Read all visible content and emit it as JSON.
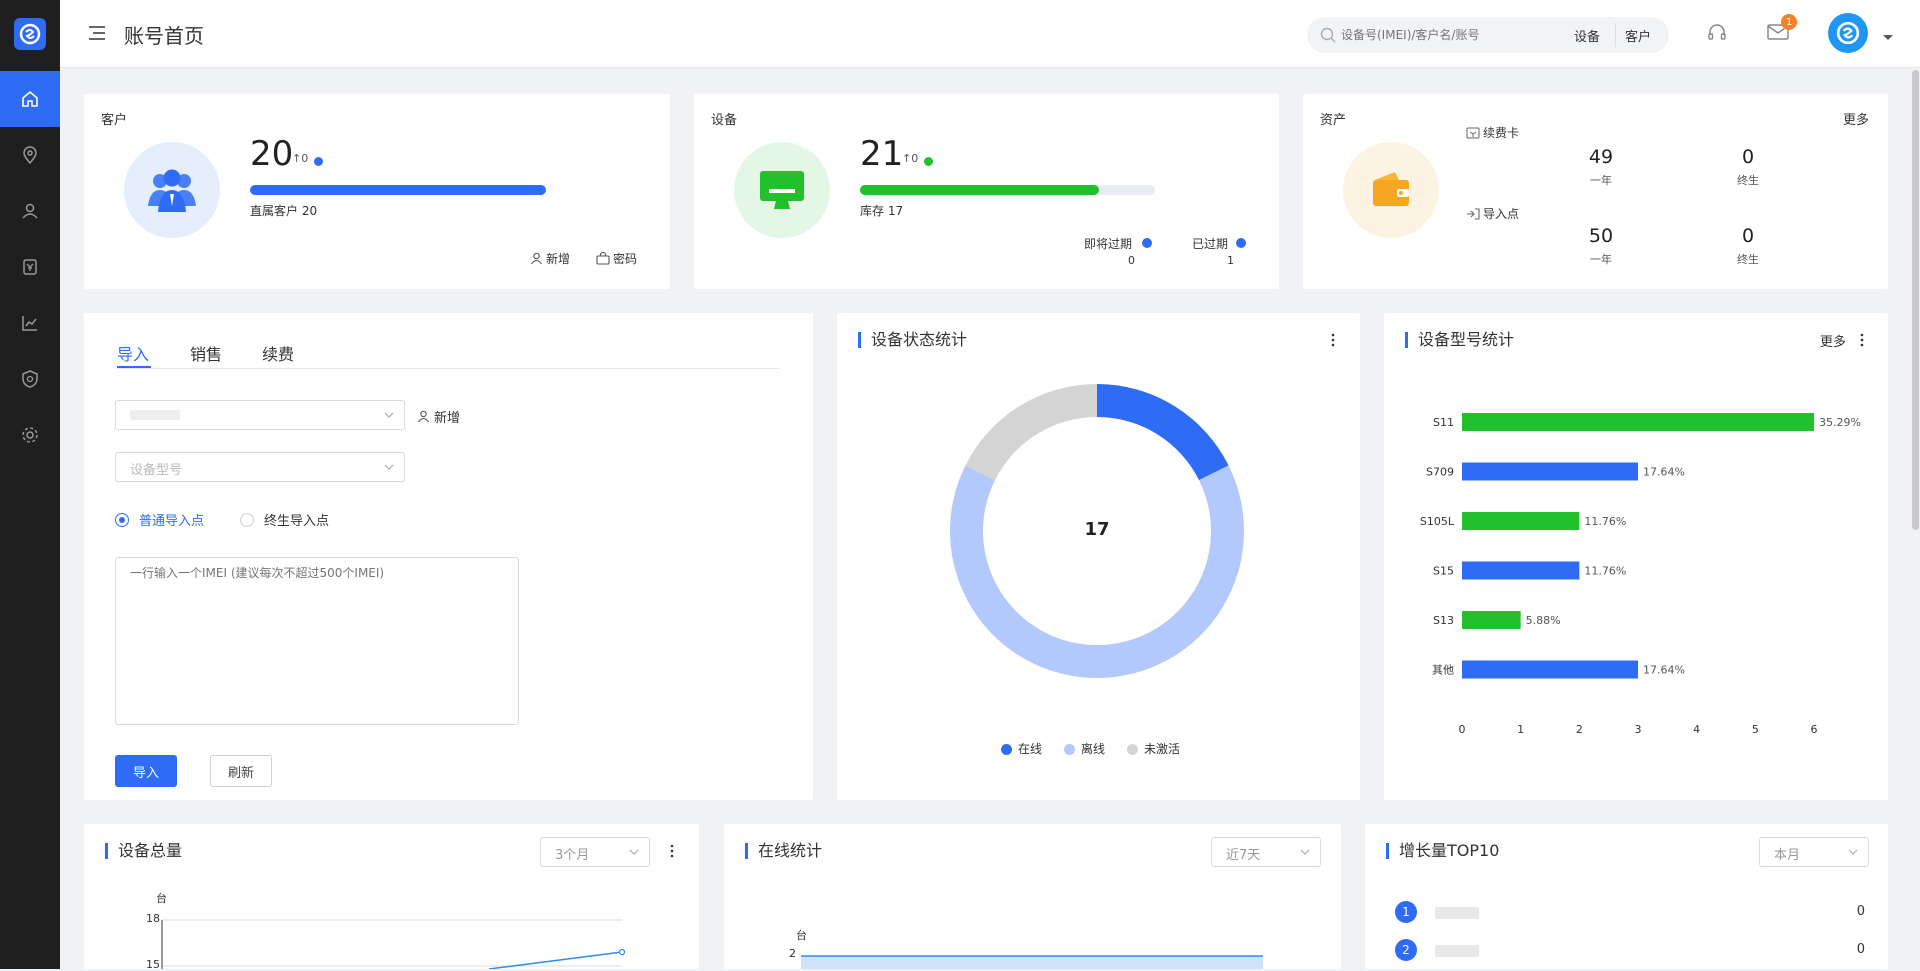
{
  "header": {
    "title": "账号首页",
    "search_placeholder": "设备号(IMEI)/客户名/账号",
    "search_scope_device": "设备",
    "search_scope_customer": "客户",
    "mail_badge": "1"
  },
  "customer_card": {
    "title": "客户",
    "count": "20",
    "delta": "↑0",
    "sub_label": "直属客户 20",
    "progress": 1.0,
    "add_label": "新增",
    "password_label": "密码"
  },
  "device_card": {
    "title": "设备",
    "count": "21",
    "delta": "↑0",
    "sub_label": "库存 17",
    "progress": 0.81,
    "expiring_label": "即将过期",
    "expiring_value": "0",
    "expired_label": "已过期",
    "expired_value": "1"
  },
  "asset_card": {
    "title": "资产",
    "more": "更多",
    "renew_card_label": "续费卡",
    "import_point_label": "导入点",
    "renew_one_year": "49",
    "renew_lifetime": "0",
    "import_one_year": "50",
    "import_lifetime": "0",
    "one_year_label": "一年",
    "lifetime_label": "终生"
  },
  "import_panel": {
    "tabs": [
      "导入",
      "销售",
      "续费"
    ],
    "add_label": "新增",
    "model_placeholder": "设备型号",
    "radio_normal": "普通导入点",
    "radio_lifetime": "终生导入点",
    "textarea_placeholder": "一行输入一个IMEI (建议每次不超过500个IMEI)",
    "import_button": "导入",
    "refresh_button": "刷新"
  },
  "status_chart": {
    "title": "设备状态统计",
    "center_value": "17",
    "legend": [
      "在线",
      "离线",
      "未激活"
    ],
    "colors": {
      "online": "#2e6cf6",
      "offline": "#b3c9fb",
      "inactive": "#d4d4d4"
    },
    "chart_data": {
      "type": "pie",
      "labels": [
        "在线",
        "离线",
        "未激活"
      ],
      "values": [
        3,
        11,
        3
      ]
    }
  },
  "model_chart": {
    "title": "设备型号统计",
    "more": "更多",
    "colors": {
      "green": "#21c12c",
      "blue": "#2e6cf6"
    },
    "chart_data": {
      "type": "bar",
      "orientation": "horizontal",
      "categories": [
        "S11",
        "S709",
        "S105L",
        "S15",
        "S13",
        "其他"
      ],
      "values": [
        6,
        3,
        2,
        2,
        1,
        3
      ],
      "labels": [
        "35.29%",
        "17.64%",
        "11.76%",
        "11.76%",
        "5.88%",
        "17.64%"
      ],
      "xlim": [
        0,
        6
      ],
      "xticks": [
        "0",
        "1",
        "2",
        "3",
        "4",
        "5",
        "6"
      ]
    }
  },
  "total_devices": {
    "title": "设备总量",
    "range": "3个月",
    "unit": "台",
    "yticks": [
      "18",
      "15"
    ]
  },
  "online_stats": {
    "title": "在线统计",
    "range": "近7天",
    "unit": "台",
    "ytick": "2"
  },
  "top10": {
    "title": "增长量TOP10",
    "range": "本月",
    "rows": [
      {
        "rank": "1",
        "value": "0"
      },
      {
        "rank": "2",
        "value": "0"
      }
    ]
  }
}
